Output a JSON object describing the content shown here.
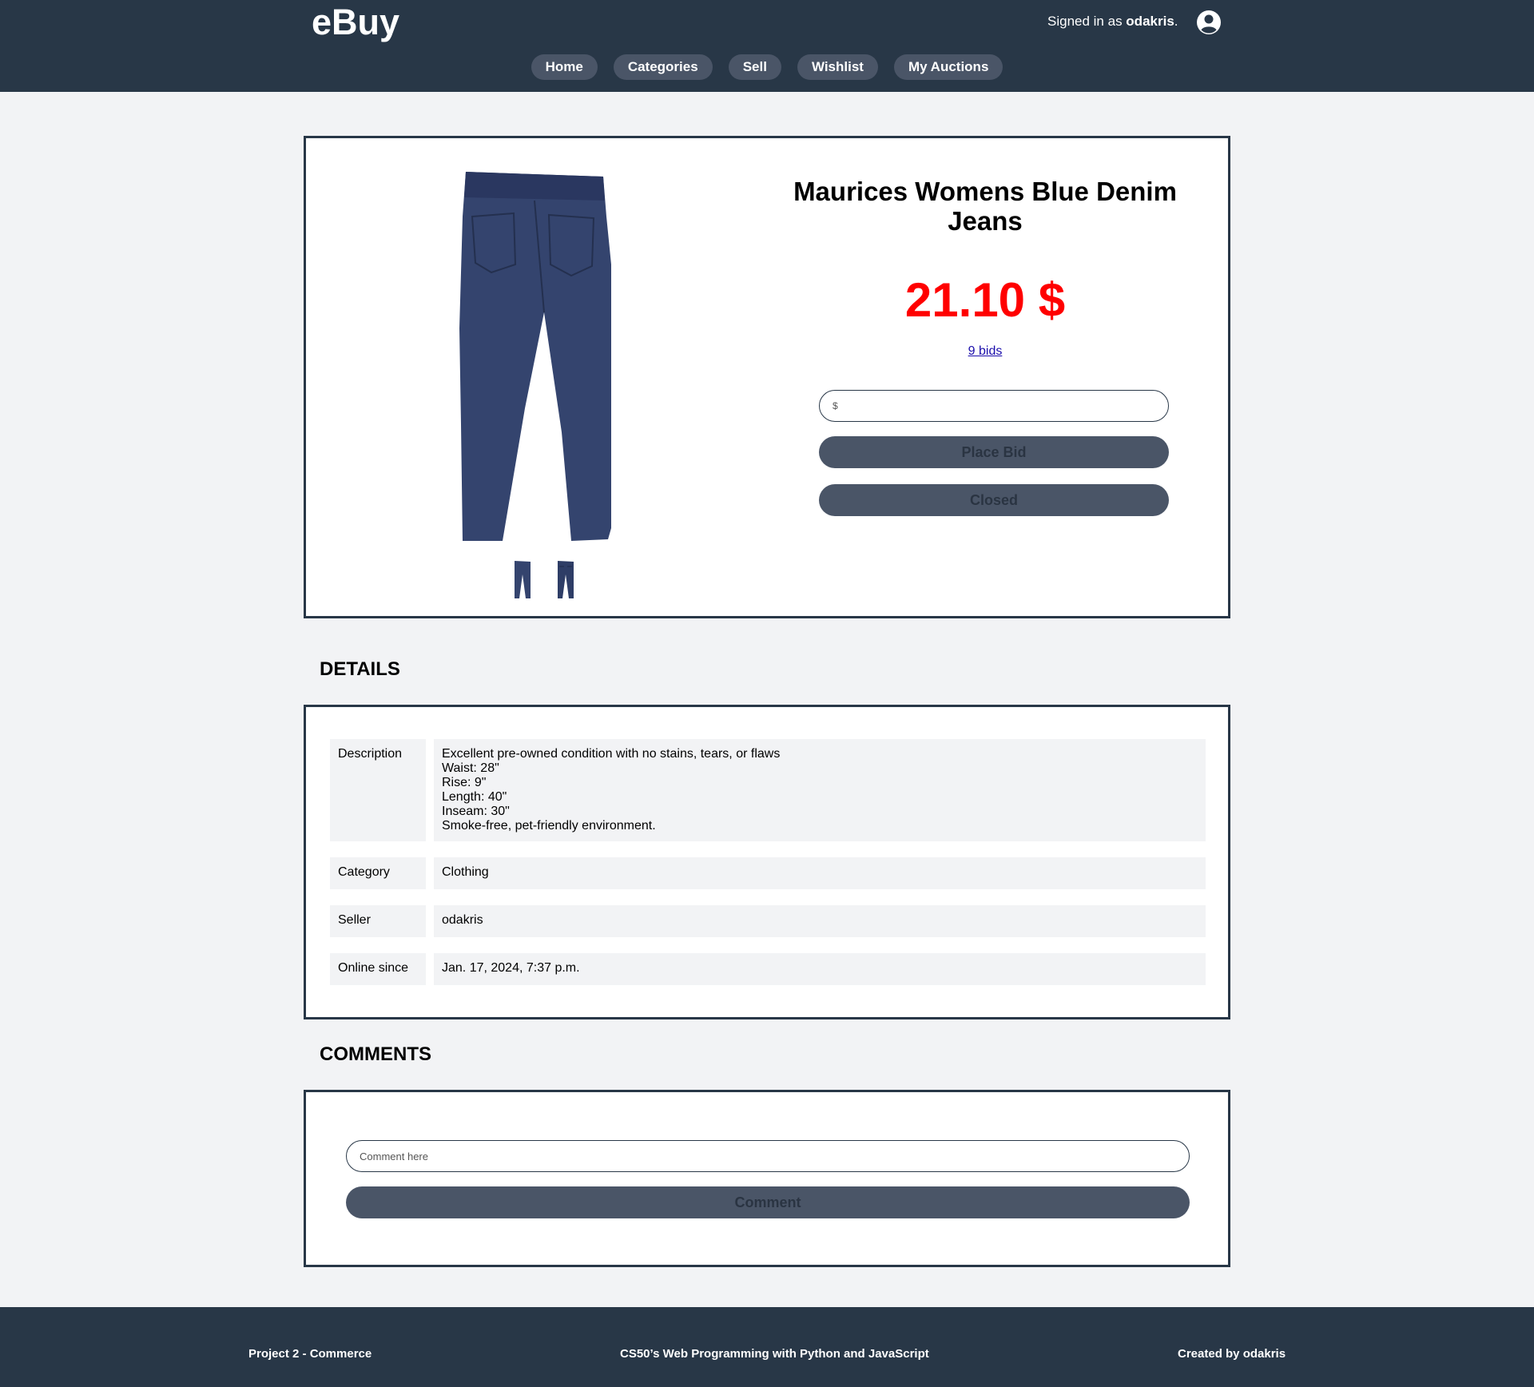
{
  "header": {
    "logo": "eBuy",
    "signed_in_prefix": "Signed in as ",
    "username": "odakris",
    "signed_in_suffix": ".",
    "nav": [
      "Home",
      "Categories",
      "Sell",
      "Wishlist",
      "My Auctions"
    ],
    "colors": {
      "background": "#283747",
      "nav_button": "#4a5567"
    }
  },
  "product": {
    "title": "Maurices Womens Blue Denim Jeans",
    "price": "21.10 $",
    "bids_link": "9 bids",
    "bid_placeholder": "$",
    "place_bid_label": "Place Bid",
    "closed_label": "Closed",
    "price_color": "#ff0000"
  },
  "details": {
    "heading": "DETAILS",
    "description_label": "Description",
    "description_lines": [
      "Excellent pre-owned condition with no stains, tears, or flaws",
      "Waist: 28\"",
      "Rise: 9\"",
      "Length: 40\"",
      "Inseam: 30\"",
      "Smoke-free, pet-friendly environment."
    ],
    "category_label": "Category",
    "category": "Clothing",
    "seller_label": "Seller",
    "seller": "odakris",
    "online_label": "Online since",
    "online_since": "Jan. 17, 2024, 7:37 p.m."
  },
  "comments": {
    "heading": "COMMENTS",
    "placeholder": "Comment here",
    "button_label": "Comment"
  },
  "footer": {
    "left": "Project 2 - Commerce",
    "center": "CS50’s Web Programming with Python and JavaScript",
    "right": "Created by odakris"
  }
}
